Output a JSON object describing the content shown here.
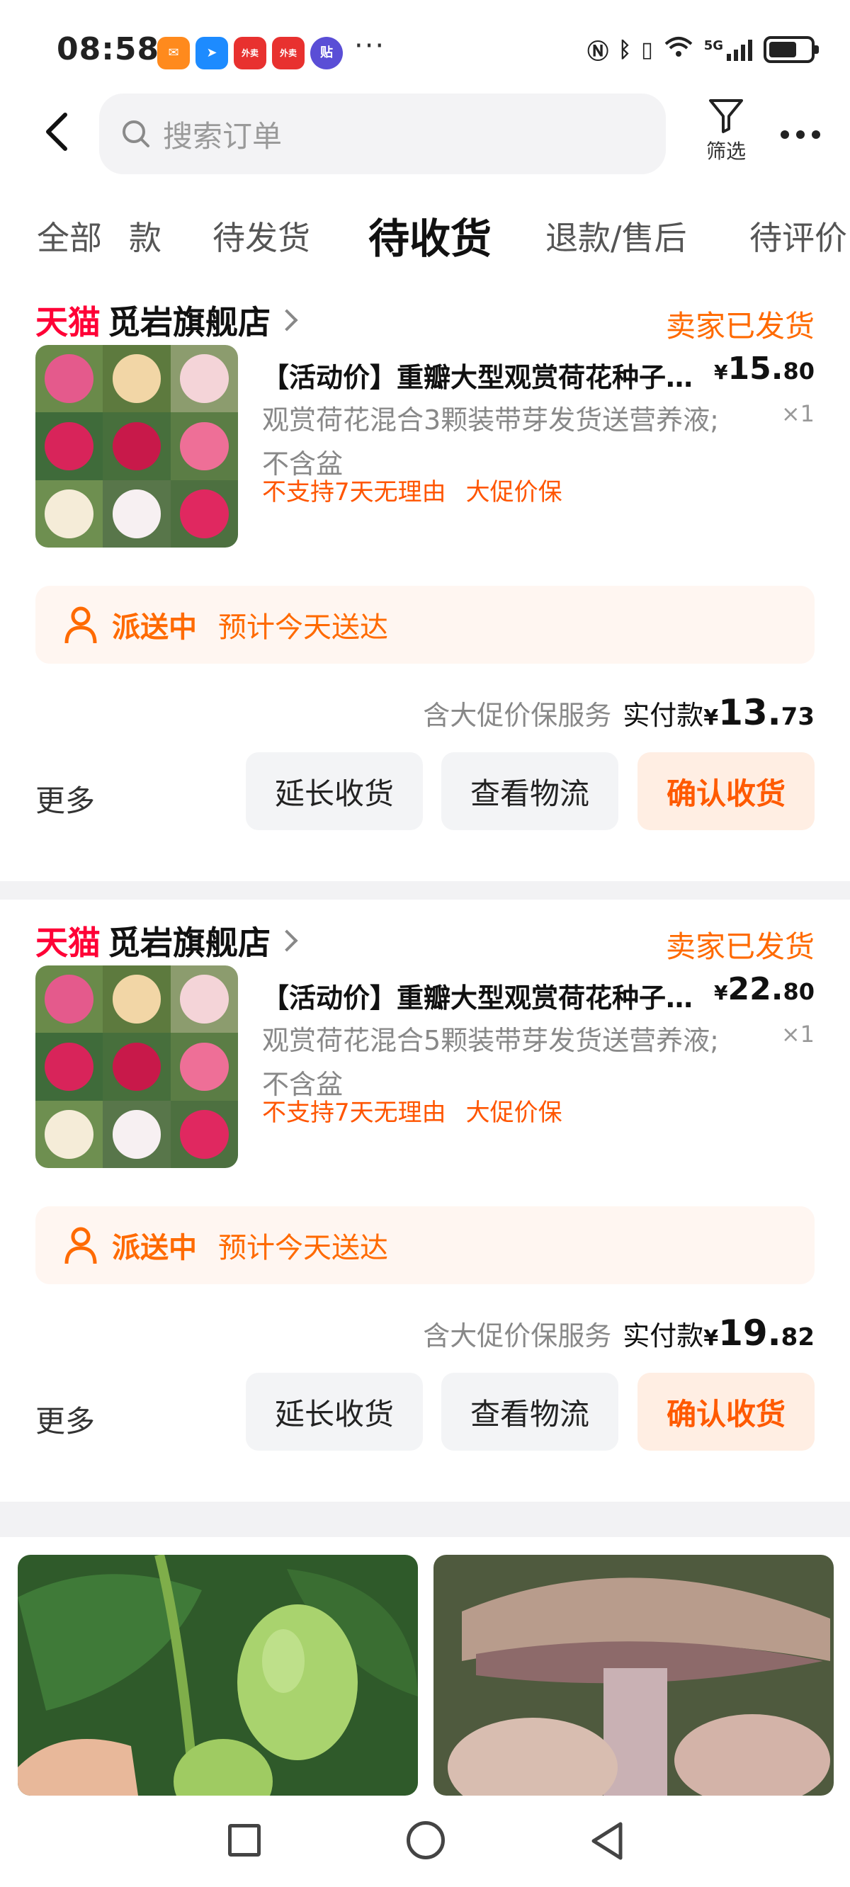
{
  "status_bar": {
    "time": "08:58",
    "app_icons": [
      {
        "name": "mail-app",
        "color": "#ff8a1d",
        "glyph": "✉"
      },
      {
        "name": "paper-plane-app",
        "color": "#1d8bff",
        "glyph": "➤"
      },
      {
        "name": "takeout-app-1",
        "color": "#e8312f",
        "glyph": "点外卖"
      },
      {
        "name": "takeout-app-2",
        "color": "#e8312f",
        "glyph": "点外卖"
      },
      {
        "name": "tieba-app",
        "color": "#5a4ed6",
        "glyph": "贴"
      }
    ],
    "dots": "···",
    "network": "5G"
  },
  "top_nav": {
    "search_placeholder": "搜索订单",
    "filter_label": "筛选"
  },
  "tabs": [
    {
      "label": "全部"
    },
    {
      "label": "款"
    },
    {
      "label": "待发货"
    },
    {
      "label": "待收货",
      "active": true
    },
    {
      "label": "退款/售后"
    },
    {
      "label": "待评价"
    }
  ],
  "orders": [
    {
      "brand": "天猫",
      "shop": "觅岩旗舰店",
      "status": "卖家已发货",
      "title": "【活动价】重瓣大型观赏荷花种子碗莲",
      "price_symbol": "¥",
      "price_int": "15.",
      "price_dec": "80",
      "qty": "×1",
      "spec": "观赏荷花混合3颗装带芽发货送营养液;不含盆",
      "tags": [
        "不支持7天无理由",
        "大促价保"
      ],
      "delivery_status": "派送中",
      "delivery_eta": "预计今天送达",
      "service": "含大促价保服务",
      "paid_label": "实付款",
      "paid_symbol": "¥",
      "paid_int": "13.",
      "paid_dec": "73",
      "more": "更多",
      "btn_extend": "延长收货",
      "btn_logistics": "查看物流",
      "btn_confirm": "确认收货"
    },
    {
      "brand": "天猫",
      "shop": "觅岩旗舰店",
      "status": "卖家已发货",
      "title": "【活动价】重瓣大型观赏荷花种子碗莲",
      "price_symbol": "¥",
      "price_int": "22.",
      "price_dec": "80",
      "qty": "×1",
      "spec": "观赏荷花混合5颗装带芽发货送营养液;不含盆",
      "tags": [
        "不支持7天无理由",
        "大促价保"
      ],
      "delivery_status": "派送中",
      "delivery_eta": "预计今天送达",
      "service": "含大促价保服务",
      "paid_label": "实付款",
      "paid_symbol": "¥",
      "paid_int": "19.",
      "paid_dec": "82",
      "more": "更多",
      "btn_extend": "延长收货",
      "btn_logistics": "查看物流",
      "btn_confirm": "确认收货"
    }
  ],
  "recommendations": [
    {
      "name": "green-melon-product"
    },
    {
      "name": "mushroom-product"
    }
  ],
  "colors": {
    "accent_orange": "#ff6a00",
    "tmall_red": "#ff0036",
    "confirm_bg": "#ffeee3",
    "delivery_bg": "#fff6f1"
  }
}
